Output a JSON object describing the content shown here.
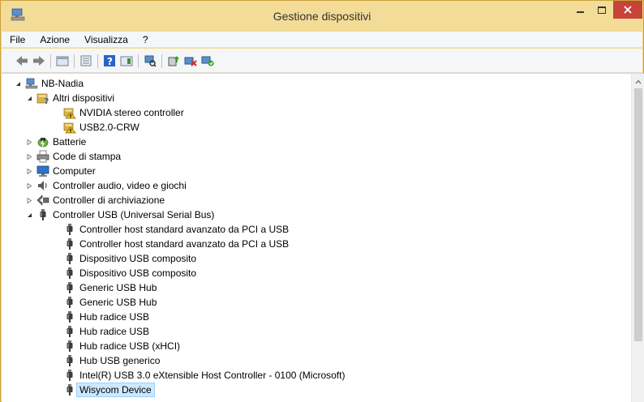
{
  "window": {
    "title": "Gestione dispositivi",
    "colors": {
      "frame": "#f3dc97",
      "close": "#c7433a",
      "selection": "#cde8ff",
      "selection_border": "#99d1ff"
    }
  },
  "menu": {
    "items": [
      "File",
      "Azione",
      "Visualizza",
      "?"
    ]
  },
  "toolbar": {
    "buttons": [
      "back-icon",
      "forward-icon",
      "properties-sheet-icon",
      "list-view-icon",
      "help-icon",
      "panel-icon",
      "scan-hardware-icon",
      "update-driver-icon",
      "uninstall-icon",
      "enable-device-icon"
    ]
  },
  "tree": {
    "nodes": [
      {
        "label": "NB-Nadia",
        "level": 0,
        "expander": "expanded",
        "icon": "computer-host-icon"
      },
      {
        "label": "Altri dispositivi",
        "level": 1,
        "expander": "expanded",
        "icon": "unknown-device-icon"
      },
      {
        "label": "NVIDIA stereo controller",
        "level": 2,
        "expander": "none",
        "icon": "warning-device-icon"
      },
      {
        "label": "USB2.0-CRW",
        "level": 2,
        "expander": "none",
        "icon": "warning-device-icon"
      },
      {
        "label": "Batterie",
        "level": 1,
        "expander": "collapsed",
        "icon": "battery-icon"
      },
      {
        "label": "Code di stampa",
        "level": 1,
        "expander": "collapsed",
        "icon": "printer-icon"
      },
      {
        "label": "Computer",
        "level": 1,
        "expander": "collapsed",
        "icon": "computer-icon"
      },
      {
        "label": "Controller audio, video e giochi",
        "level": 1,
        "expander": "collapsed",
        "icon": "speaker-icon"
      },
      {
        "label": "Controller di archiviazione",
        "level": 1,
        "expander": "collapsed",
        "icon": "storage-controller-icon"
      },
      {
        "label": "Controller USB (Universal Serial Bus)",
        "level": 1,
        "expander": "expanded",
        "icon": "usb-plug-icon"
      },
      {
        "label": "Controller host standard avanzato da PCI a USB",
        "level": 2,
        "expander": "none",
        "icon": "usb-plug-icon"
      },
      {
        "label": "Controller host standard avanzato da PCI a USB",
        "level": 2,
        "expander": "none",
        "icon": "usb-plug-icon"
      },
      {
        "label": "Dispositivo USB composito",
        "level": 2,
        "expander": "none",
        "icon": "usb-plug-icon"
      },
      {
        "label": "Dispositivo USB composito",
        "level": 2,
        "expander": "none",
        "icon": "usb-plug-icon"
      },
      {
        "label": "Generic USB Hub",
        "level": 2,
        "expander": "none",
        "icon": "usb-plug-icon"
      },
      {
        "label": "Generic USB Hub",
        "level": 2,
        "expander": "none",
        "icon": "usb-plug-icon"
      },
      {
        "label": "Hub radice USB",
        "level": 2,
        "expander": "none",
        "icon": "usb-plug-icon"
      },
      {
        "label": "Hub radice USB",
        "level": 2,
        "expander": "none",
        "icon": "usb-plug-icon"
      },
      {
        "label": "Hub radice USB (xHCI)",
        "level": 2,
        "expander": "none",
        "icon": "usb-plug-icon"
      },
      {
        "label": "Hub USB generico",
        "level": 2,
        "expander": "none",
        "icon": "usb-plug-icon"
      },
      {
        "label": "Intel(R) USB 3.0 eXtensible Host Controller - 0100 (Microsoft)",
        "level": 2,
        "expander": "none",
        "icon": "usb-plug-icon"
      },
      {
        "label": "Wisycom Device",
        "level": 2,
        "expander": "none",
        "icon": "usb-plug-icon",
        "selected": true
      }
    ]
  }
}
